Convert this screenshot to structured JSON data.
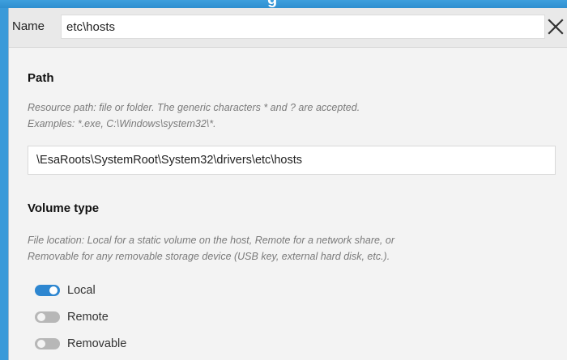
{
  "header": {
    "name_label": "Name",
    "name_value": "etc\\hosts",
    "close_icon": "close-icon"
  },
  "path": {
    "title": "Path",
    "help_line1": "Resource path: file or folder. The generic characters * and ? are accepted.",
    "help_line2": "Examples: *.exe, C:\\Windows\\system32\\*.",
    "value": "\\EsaRoots\\SystemRoot\\System32\\drivers\\etc\\hosts"
  },
  "volume_type": {
    "title": "Volume type",
    "help_line1": "File location: Local for a static volume on the host, Remote for a network share, or",
    "help_line2": "Removable for any removable storage device (USB key, external hard disk, etc.).",
    "options": [
      {
        "label": "Local",
        "on": true
      },
      {
        "label": "Remote",
        "on": false
      },
      {
        "label": "Removable",
        "on": false
      }
    ]
  },
  "colors": {
    "accent": "#2d86d0",
    "toggle_off": "#b7b7b7",
    "panel_background": "#f3f3f3",
    "window_background": "#3a9ad9"
  }
}
